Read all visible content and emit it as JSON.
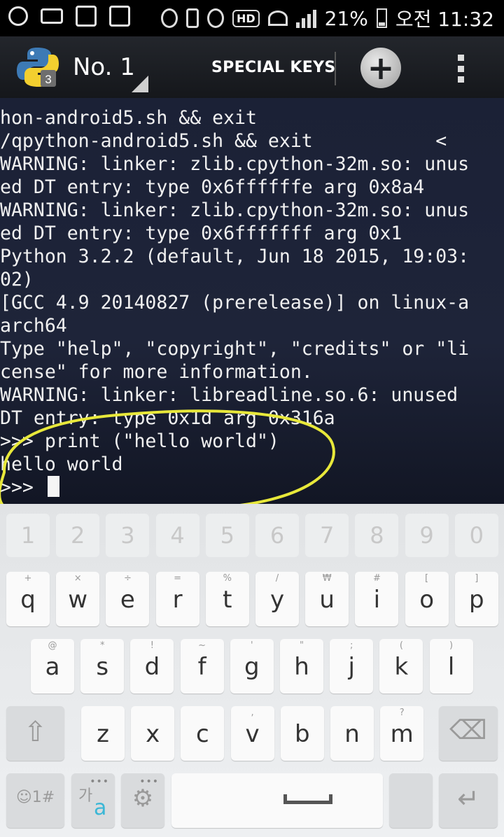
{
  "status_bar": {
    "battery": "21%",
    "time": "오전 11:32",
    "hd": "HD"
  },
  "app_bar": {
    "title": "No. 1",
    "logo_badge": "3",
    "special_keys": "SPECIAL KEYS",
    "add": "+"
  },
  "terminal": {
    "lines": [
      "hon-android5.sh && exit",
      "/qpython-android5.sh && exit           <",
      "WARNING: linker: zlib.cpython-32m.so: unus",
      "ed DT entry: type 0x6ffffffe arg 0x8a4",
      "WARNING: linker: zlib.cpython-32m.so: unus",
      "ed DT entry: type 0x6fffffff arg 0x1",
      "Python 3.2.2 (default, Jun 18 2015, 19:03:",
      "02)",
      "[GCC 4.9 20140827 (prerelease)] on linux-a",
      "arch64",
      "Type \"help\", \"copyright\", \"credits\" or \"li",
      "cense\" for more information.",
      "WARNING: linker: libreadline.so.6: unused",
      "DT entry: type 0x1d arg 0x316a",
      ">>> print (\"hello world\")",
      "hello world",
      ">>> "
    ]
  },
  "keyboard": {
    "numbers": [
      "1",
      "2",
      "3",
      "4",
      "5",
      "6",
      "7",
      "8",
      "9",
      "0"
    ],
    "row1": [
      {
        "k": "q",
        "h": "+"
      },
      {
        "k": "w",
        "h": "×"
      },
      {
        "k": "e",
        "h": "÷"
      },
      {
        "k": "r",
        "h": "="
      },
      {
        "k": "t",
        "h": "%"
      },
      {
        "k": "y",
        "h": "/"
      },
      {
        "k": "u",
        "h": "₩"
      },
      {
        "k": "i",
        "h": "#"
      },
      {
        "k": "o",
        "h": "["
      },
      {
        "k": "p",
        "h": "]"
      }
    ],
    "row2": [
      {
        "k": "a",
        "h": "@"
      },
      {
        "k": "s",
        "h": "*"
      },
      {
        "k": "d",
        "h": "!"
      },
      {
        "k": "f",
        "h": "~"
      },
      {
        "k": "g",
        "h": "'"
      },
      {
        "k": "h",
        "h": "\""
      },
      {
        "k": "j",
        "h": ";"
      },
      {
        "k": "k",
        "h": "("
      },
      {
        "k": "l",
        "h": ")"
      }
    ],
    "row3": [
      {
        "k": "z",
        "h": ""
      },
      {
        "k": "x",
        "h": ""
      },
      {
        "k": "c",
        "h": ""
      },
      {
        "k": "v",
        "h": ","
      },
      {
        "k": "b",
        "h": ""
      },
      {
        "k": "n",
        "h": ""
      },
      {
        "k": "m",
        "h": "?"
      }
    ],
    "shift": "⇧",
    "backspace": "⌫",
    "sym": "☺1#",
    "lang_top": "가",
    "lang_bottom": "a",
    "settings": "⚙",
    "enter": "↵"
  },
  "colors": {
    "terminal_bg": "#1d2338",
    "highlight_circle": "#e8e83a",
    "lang_accent": "#3bb7d6"
  }
}
